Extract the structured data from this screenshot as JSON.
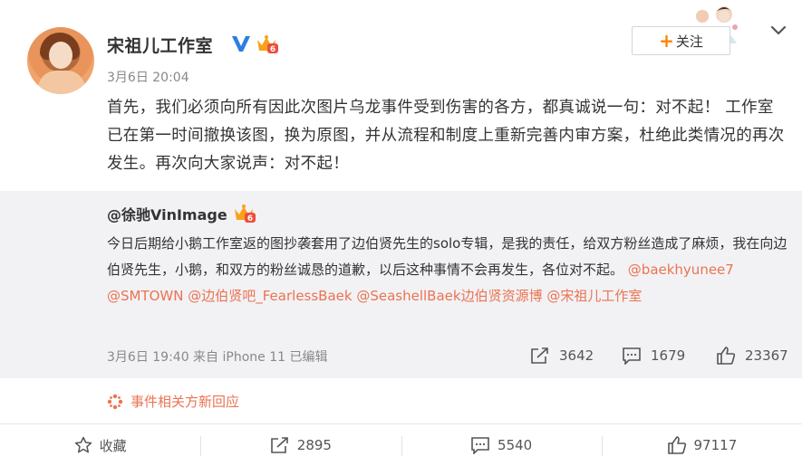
{
  "post": {
    "username": "宋祖儿工作室",
    "time": "3月6日 20:04",
    "text": "首先，我们必须向所有因此次图片乌龙事件受到伤害的各方，都真诚说一句：对不起！  工作室已在第一时间撤换该图，换为原图，并从流程和制度上重新完善内审方案，杜绝此类情况的再次发生。再次向大家说声：对不起！",
    "follow_label": "关注",
    "follow_plus": "+"
  },
  "repost": {
    "username": "@徐驰VinImage",
    "text": "今日后期给小鹅工作室返的图抄袭套用了边伯贤先生的solo专辑，是我的责任，给双方粉丝造成了麻烦，我在向边伯贤先生，小鹅，和双方的粉丝诚恳的道歉，以后这种事情不会再发生，各位对不起。",
    "mentions": "@baekhyunee7 @SMTOWN @边伯贤吧_FearlessBaek @SeashellBaek边伯贤资源博 @宋祖儿工作室",
    "meta": "3月6日 19:40 来自 iPhone 11  已编辑",
    "reposts": "3642",
    "comments": "1679",
    "likes": "23367"
  },
  "related_link": "事件相关方新回应",
  "bottom": {
    "favorite": "收藏",
    "reposts": "2895",
    "comments": "5540",
    "likes": "97117"
  },
  "colors": {
    "accent": "#eb7350",
    "follow_plus": "#ff8200",
    "verified": "#2d7fe0",
    "repost_bg": "#f2f2f5"
  }
}
